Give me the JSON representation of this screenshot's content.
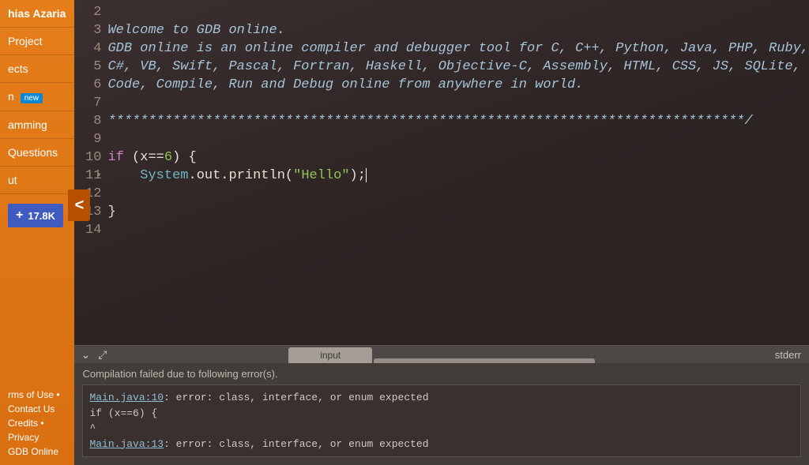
{
  "sidebar": {
    "user": "hias Azaria",
    "items": [
      {
        "label": "Project"
      },
      {
        "label": "ects"
      },
      {
        "label": "n",
        "badge": "new"
      },
      {
        "label": "amming"
      },
      {
        "label": "Questions"
      },
      {
        "label": "ut"
      }
    ],
    "share_count": "17.8K",
    "collapse_glyph": "<",
    "footer_line1": "rms of Use • Contact Us",
    "footer_line2": "Credits • Privacy",
    "footer_line3": "GDB Online"
  },
  "editor": {
    "lines": [
      {
        "n": 2,
        "type": "blank"
      },
      {
        "n": 3,
        "type": "comment",
        "text": "Welcome to GDB online."
      },
      {
        "n": 4,
        "type": "comment",
        "text": "GDB online is an online compiler and debugger tool for C, C++, Python, Java, PHP, Ruby,"
      },
      {
        "n": 5,
        "type": "comment",
        "text": "C#, VB, Swift, Pascal, Fortran, Haskell, Objective-C, Assembly, HTML, CSS, JS, SQLite,"
      },
      {
        "n": 6,
        "type": "comment",
        "text": "Code, Compile, Run and Debug online from anywhere in world."
      },
      {
        "n": 7,
        "type": "blank"
      },
      {
        "n": 8,
        "type": "comment",
        "text": "*******************************************************************************/"
      },
      {
        "n": 9,
        "type": "blank"
      },
      {
        "n": 10,
        "type": "code-if",
        "fold": true,
        "kw": "if",
        "var": "x",
        "op": "==",
        "num": "6"
      },
      {
        "n": 11,
        "type": "code-print",
        "cls": "System",
        "m1": "out",
        "m2": "println",
        "str": "\"Hello\""
      },
      {
        "n": 12,
        "type": "blank"
      },
      {
        "n": 13,
        "type": "code-close"
      },
      {
        "n": 14,
        "type": "blank"
      }
    ]
  },
  "console": {
    "chevron": "⌄",
    "expand": "⤢",
    "tab_input": "input",
    "stderr_label": "stderr",
    "message": "Compilation failed due to following error(s).",
    "errors": [
      {
        "link": "Main.java:10",
        "text": ": error: class, interface, or enum expected"
      },
      {
        "plain": "if (x==6) {"
      },
      {
        "plain": "^"
      },
      {
        "link": "Main.java:13",
        "text": ": error: class, interface, or enum expected"
      }
    ]
  }
}
